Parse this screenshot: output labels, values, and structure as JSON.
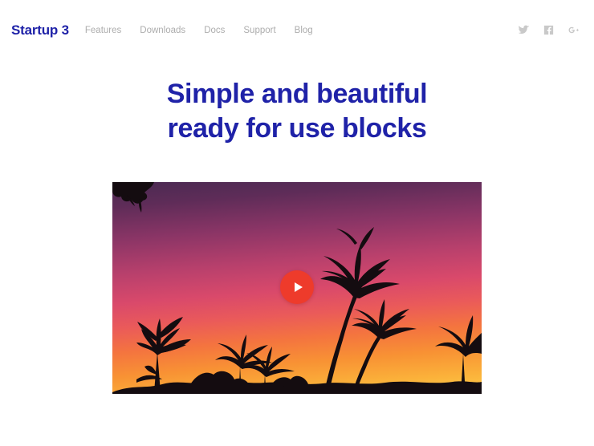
{
  "header": {
    "brand": "Startup 3",
    "nav_items": [
      {
        "label": "Features"
      },
      {
        "label": "Downloads"
      },
      {
        "label": "Docs"
      },
      {
        "label": "Support"
      },
      {
        "label": "Blog"
      }
    ],
    "social": [
      {
        "name": "twitter-icon",
        "label": "Twitter"
      },
      {
        "name": "facebook-icon",
        "label": "Facebook"
      },
      {
        "name": "googleplus-icon",
        "label": "Google Plus"
      }
    ]
  },
  "hero": {
    "headline_line1": "Simple and beautiful",
    "headline_line2": "ready for use blocks"
  },
  "video": {
    "play_label": "Play",
    "alt": "Palm tree silhouettes against an orange and purple sunset sky"
  },
  "colors": {
    "brand_blue": "#1f22a8",
    "nav_gray": "#adadad",
    "social_gray": "#c9c9c9",
    "play_red": "#ee3b2b",
    "page_background": "#ffffff",
    "sky_top": "#4a2a52",
    "sky_mid_purple": "#8e3a6e",
    "sky_magenta": "#d9496b",
    "sky_orange": "#f4743f",
    "sky_yellow": "#fbc13e",
    "silhouette": "#140c10"
  }
}
